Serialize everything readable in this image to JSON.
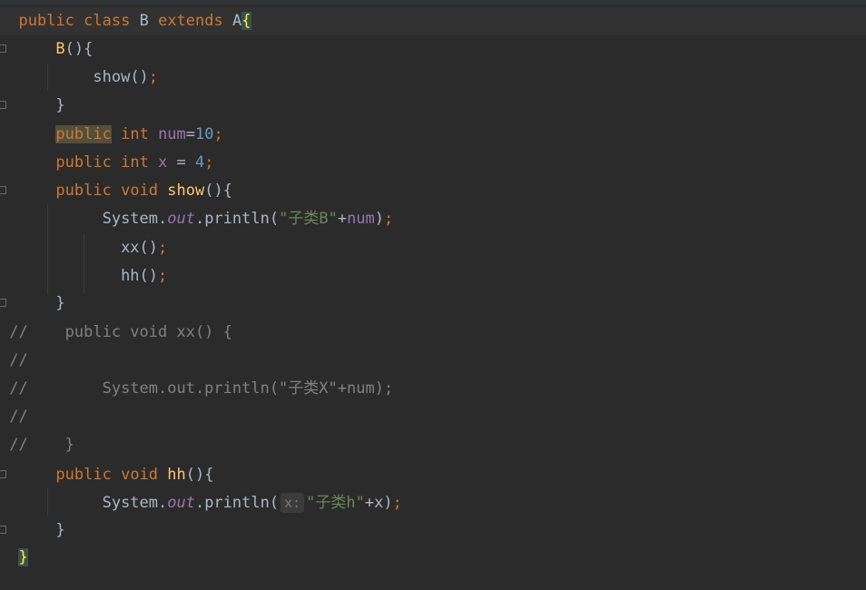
{
  "code": {
    "l1": {
      "kw_public": "public",
      "kw_class": "class",
      "class_name": "B",
      "kw_extends": "extends",
      "parent": "A",
      "brace": "{"
    },
    "l2": {
      "ctor": "B",
      "parens": "(){"
    },
    "l3": {
      "call": "show",
      "parens": "()",
      "semi": ";"
    },
    "l4": {
      "brace": "}"
    },
    "l5": {
      "kw_public": "public",
      "kw_int": "int",
      "field": "num",
      "eq": "=",
      "value": "10",
      "semi": ";"
    },
    "l6": {
      "kw_public": "public",
      "kw_int": "int",
      "field": "x",
      "eq": " = ",
      "value": "4",
      "semi": ";"
    },
    "l7": {
      "kw_public": "public",
      "kw_void": "void",
      "method": "show",
      "parens": "(){"
    },
    "l8": {
      "system": "System.",
      "out": "out",
      "println": ".println(",
      "str": "\"子类B\"",
      "plus": "+",
      "field": "num",
      "close": ")",
      "semi": ";"
    },
    "l9": {
      "call": "xx",
      "parens": "()",
      "semi": ";"
    },
    "l10": {
      "call": "hh",
      "parens": "()",
      "semi": ";"
    },
    "l11": {
      "brace": "}"
    },
    "l12": {
      "text": "//    public void xx() {"
    },
    "l13": {
      "text": "//"
    },
    "l14": {
      "text": "//        System.out.println(\"子类X\"+num);"
    },
    "l15": {
      "text": "//"
    },
    "l16": {
      "text": "//    }"
    },
    "l17": {
      "kw_public": "public",
      "kw_void": "void",
      "method": "hh",
      "parens": "(){"
    },
    "l18": {
      "system": "System.",
      "out": "out",
      "println": ".println(",
      "hint": "x:",
      "str": "\"子类h\"",
      "plus": "+",
      "arg": "x",
      "close": ")",
      "semi": ";"
    },
    "l19": {
      "brace": "}"
    },
    "l20": {
      "brace": "}"
    }
  }
}
